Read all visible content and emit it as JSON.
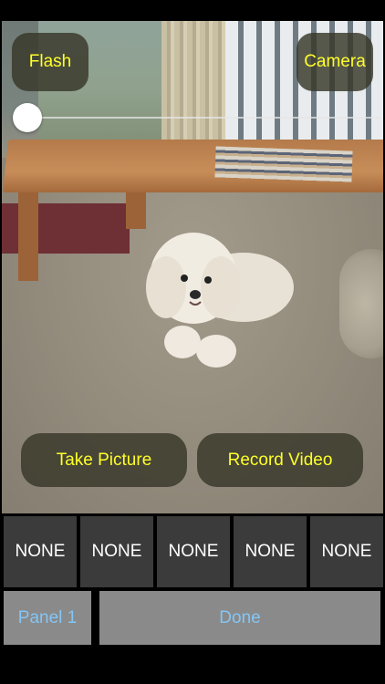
{
  "camera_overlay": {
    "flash_label": "Flash",
    "camera_label": "Camera",
    "take_picture_label": "Take Picture",
    "record_video_label": "Record Video",
    "zoom_slider_value": 0,
    "button_text_color": "#ffff2a"
  },
  "options_row": {
    "items": [
      {
        "label": "NONE"
      },
      {
        "label": "NONE"
      },
      {
        "label": "NONE"
      },
      {
        "label": "NONE"
      },
      {
        "label": "NONE"
      }
    ]
  },
  "bottom_bar": {
    "panel_label": "Panel 1",
    "done_label": "Done",
    "accent_color": "#84c5f5"
  }
}
